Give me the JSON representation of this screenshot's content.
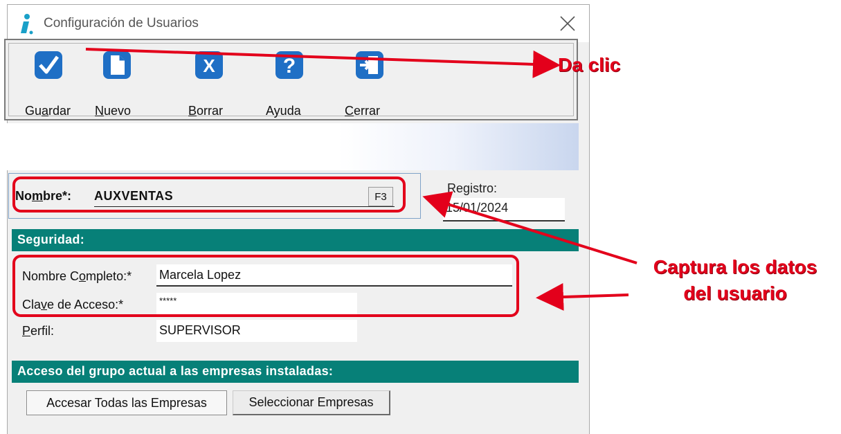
{
  "window": {
    "title": "Configuración de Usuarios",
    "close_symbol": "✕"
  },
  "toolbar": {
    "items": [
      {
        "label_pre": "Gu",
        "label_mnemonic": "a",
        "label_post": "rdar",
        "icon": "checkmark-icon"
      },
      {
        "label_pre": "",
        "label_mnemonic": "N",
        "label_post": "uevo",
        "icon": "new-document-icon"
      },
      {
        "label_pre": "",
        "label_mnemonic": "B",
        "label_post": "orrar",
        "icon": "delete-x-icon"
      },
      {
        "label_pre": "Ayuda",
        "label_mnemonic": "",
        "label_post": "",
        "icon": "help-question-icon"
      },
      {
        "label_pre": "",
        "label_mnemonic": "C",
        "label_post": "errar",
        "icon": "exit-door-icon"
      }
    ]
  },
  "nombre": {
    "label_pre": "No",
    "label_mnemonic": "m",
    "label_post": "bre*:",
    "value": "AUXVENTAS",
    "f3_label": "F3"
  },
  "registro": {
    "label": "Registro:",
    "value": "15/01/2024"
  },
  "seguridad": {
    "header": "Seguridad:",
    "nombre_completo_pre": "Nombre C",
    "nombre_completo_mnemonic": "o",
    "nombre_completo_post": "mpleto:*",
    "nombre_completo_value": "Marcela Lopez",
    "clave_pre": "Cla",
    "clave_mnemonic": "v",
    "clave_post": "e de Acceso:*",
    "clave_value": "*****",
    "perfil_pre": "",
    "perfil_mnemonic": "P",
    "perfil_post": "erfil:",
    "perfil_value": "SUPERVISOR"
  },
  "acceso": {
    "header": "Acceso del grupo actual a las empresas instaladas:",
    "all_button": "Accesar Todas las Empresas",
    "select_button": "Seleccionar Empresas"
  },
  "annotations": {
    "da_clic": "Da clic",
    "captura_line1": "Captura los datos",
    "captura_line2": "del usuario",
    "color": "#e3001b"
  },
  "colors": {
    "section_bar": "#078078",
    "icon_blue": "#1f6fc5"
  }
}
